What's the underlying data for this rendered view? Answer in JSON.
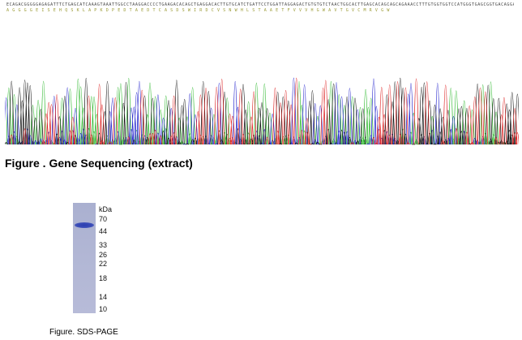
{
  "sequencing": {
    "dna": "ECAGACGGGGGAGAGATTTCTGAGCATCAAAGTAAATTGGCCTAAGGACCCCTGAAGACACAGCTGAGGACACTTGTGCATCTGATTCCTGGATTAGGAGACTGTGTGTCTAACTGGCACTTGAGCACAGCAGCAGAAACCTTTGTGGTGGTCCATGGGTGAGCGGTGACAGGAGTATGTATGAGAGTTGGGTG",
    "aa": "A G G G G E I S E H Q S K L A P K D P E D T A E D T C A S D S W I R D C V S N W H L S T A A E T F V V V H G W A V T G V C M R V G W",
    "caption": "Figure . Gene Sequencing (extract)",
    "base_colors": {
      "A": "#2db82d",
      "C": "#2222cc",
      "G": "#111111",
      "T": "#dd2222"
    }
  },
  "gel": {
    "unit": "kDa",
    "markers": [
      "70",
      "44",
      "33",
      "26",
      "22",
      "18",
      "14",
      "10"
    ],
    "caption": "Figure. SDS-PAGE"
  }
}
